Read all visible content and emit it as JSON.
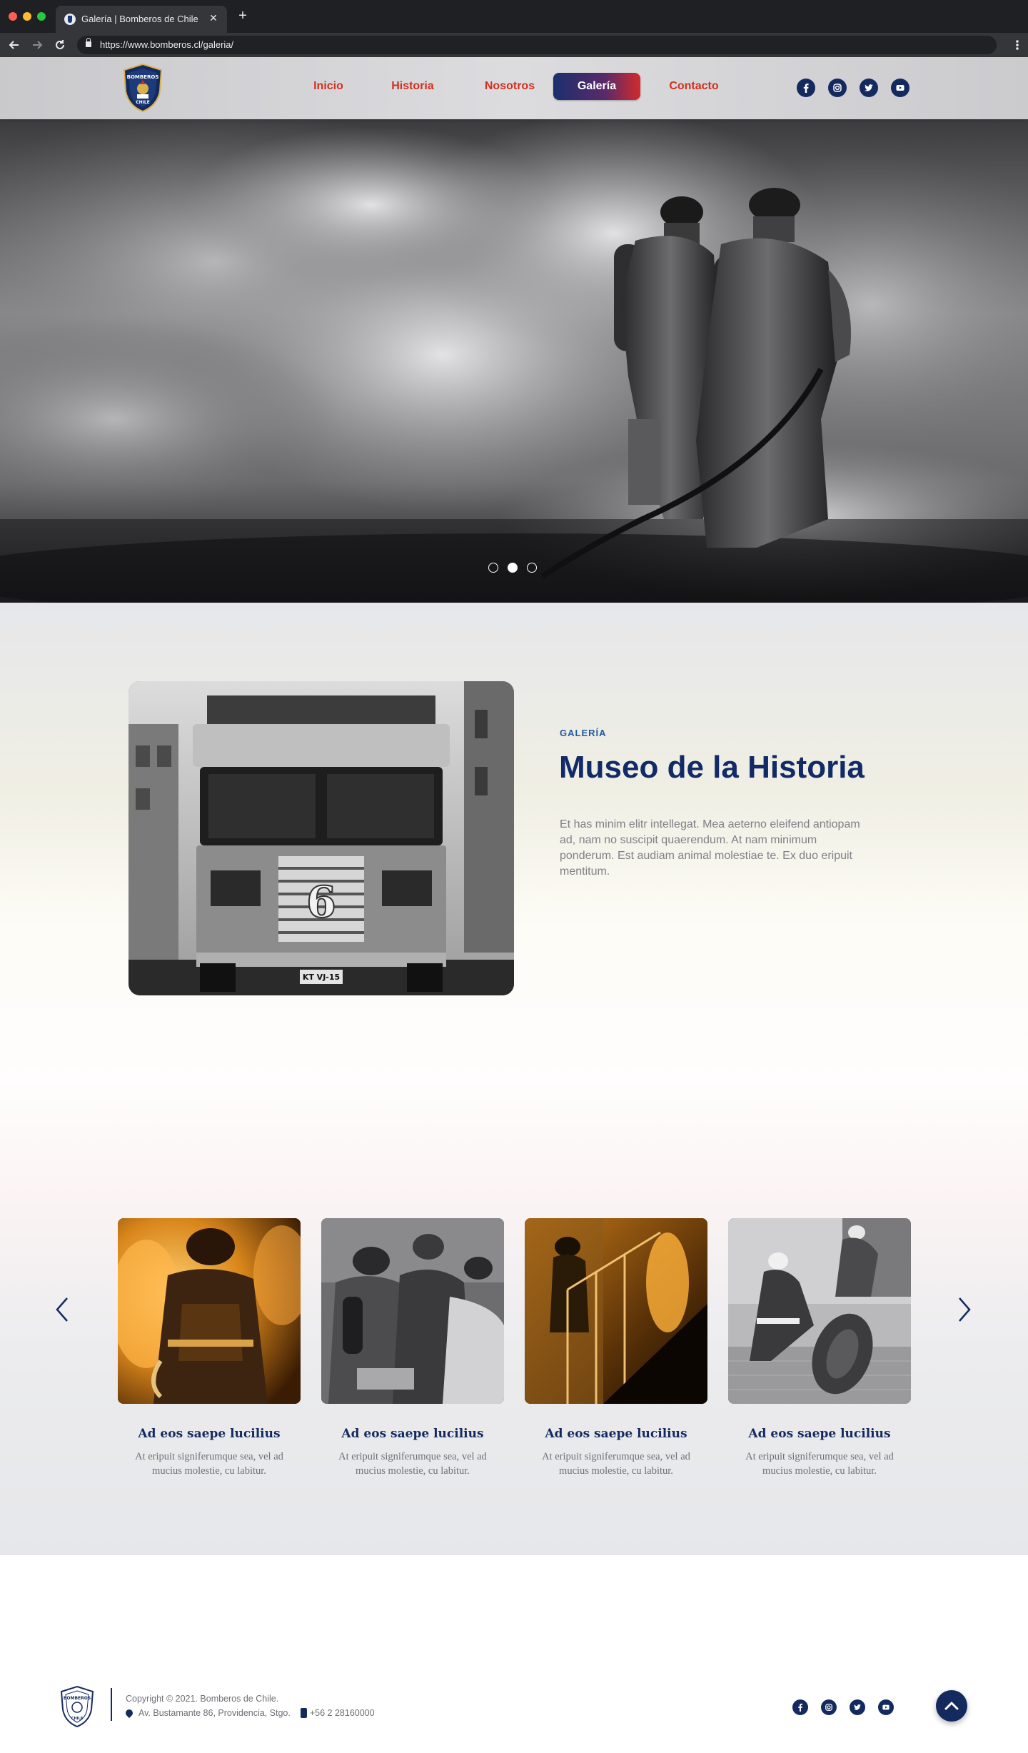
{
  "browser": {
    "tab_title": "Galería | Bomberos de Chile",
    "tab_close": "✕",
    "new_tab": "+",
    "url": "https://www.bomberos.cl/galeria/",
    "nav_icons": [
      "back-arrow-icon",
      "forward-arrow-icon",
      "reload-icon",
      "lock-icon",
      "kebab-menu-icon"
    ]
  },
  "header": {
    "logo_text_top": "BOMBEROS",
    "logo_text_bottom": "CHILE",
    "nav": [
      {
        "label": "Inicio",
        "active": false
      },
      {
        "label": "Historia",
        "active": false
      },
      {
        "label": "Nosotros",
        "active": false
      },
      {
        "label": "Galería",
        "active": true
      },
      {
        "label": "Contacto",
        "active": false
      }
    ],
    "socials": [
      "facebook-icon",
      "instagram-icon",
      "twitter-icon",
      "youtube-icon"
    ]
  },
  "hero": {
    "slide_count": 3,
    "active_slide": 2
  },
  "museum": {
    "eyebrow": "GALERÍA",
    "title": "Museo de la Historia",
    "body": "Et has minim elitr intellegat. Mea aeterno eleifend antiopam ad, nam no suscipit quaerendum. At nam minimum ponderum. Est audiam animal molestiae te. Ex duo eripuit mentitum.",
    "truck_plate": "KT VJ-15",
    "truck_number": "6"
  },
  "cards": [
    {
      "title": "Ad eos saepe lucilius",
      "text": "At eripuit signiferumque sea, vel ad mucius molestie, cu labitur."
    },
    {
      "title": "Ad eos saepe lucilius",
      "text": "At eripuit signiferumque sea, vel ad mucius molestie, cu labitur."
    },
    {
      "title": "Ad eos saepe lucilius",
      "text": "At eripuit signiferumque sea, vel ad mucius molestie, cu labitur."
    },
    {
      "title": "Ad eos saepe lucilius",
      "text": "At eripuit signiferumque sea, vel ad mucius molestie, cu labitur."
    }
  ],
  "footer": {
    "copyright": "Copyright © 2021. Bomberos de Chile.",
    "address": "Av. Bustamante 86, Providencia, Stgo.",
    "phone": "+56 2 28160000"
  },
  "colors": {
    "brand_navy": "#142a5f",
    "nav_red": "#d42f1e",
    "active_gradient_start": "#1b2f6e",
    "active_gradient_end": "#d32a2a"
  }
}
